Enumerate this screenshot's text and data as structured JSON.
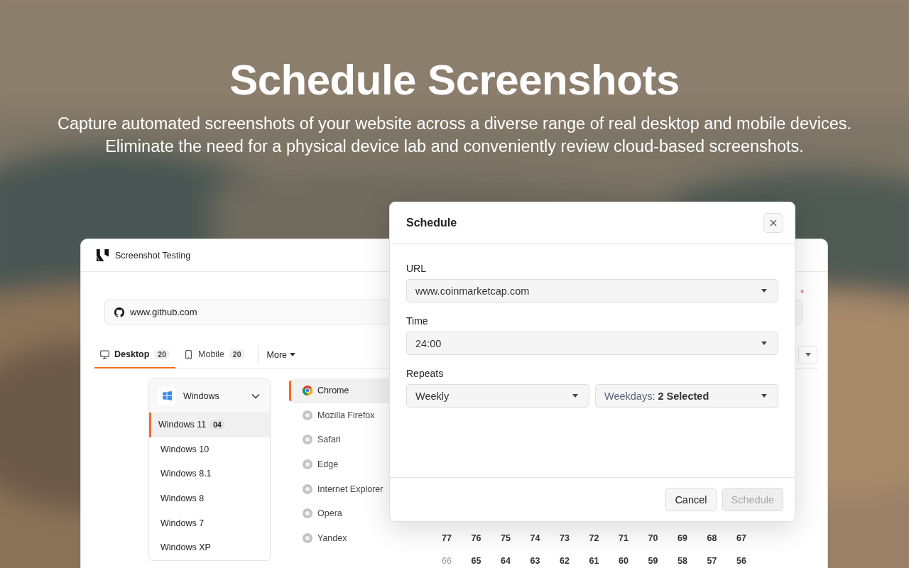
{
  "hero": {
    "title": "Schedule Screenshots",
    "subtitle_lines": [
      "Capture automated screenshots of your website across a diverse range of real desktop and mobile devices.",
      "Eliminate the need for a physical device lab and conveniently review cloud-based screenshots."
    ]
  },
  "app": {
    "title": "Screenshot Testing",
    "url": "www.github.com",
    "required_mark": "*",
    "tabs": [
      {
        "label": "Desktop",
        "count": "20",
        "selected": true,
        "kind": "desktop"
      },
      {
        "label": "Mobile",
        "count": "20",
        "selected": false,
        "kind": "mobile"
      }
    ],
    "more": "More",
    "os_group": {
      "label": "Windows",
      "expanded": true
    },
    "os_versions": [
      {
        "label": "Windows 11",
        "badge": "04",
        "selected": true
      },
      {
        "label": "Windows 10",
        "selected": false
      },
      {
        "label": "Windows 8.1",
        "selected": false
      },
      {
        "label": "Windows 8",
        "selected": false
      },
      {
        "label": "Windows 7",
        "selected": false
      },
      {
        "label": "Windows XP",
        "selected": false
      }
    ],
    "browsers": [
      {
        "label": "Chrome",
        "selected": true
      },
      {
        "label": "Mozilla Firefox",
        "selected": false
      },
      {
        "label": "Safari",
        "selected": false
      },
      {
        "label": "Edge",
        "selected": false
      },
      {
        "label": "Internet Explorer",
        "selected": false
      },
      {
        "label": "Opera",
        "selected": false
      },
      {
        "label": "Yandex",
        "selected": false
      }
    ],
    "grid_rows": [
      [
        {
          "value": "77",
          "disabled": false
        },
        {
          "value": "76",
          "disabled": false
        },
        {
          "value": "75",
          "disabled": false
        },
        {
          "value": "74",
          "disabled": false
        },
        {
          "value": "73",
          "disabled": false
        },
        {
          "value": "72",
          "disabled": false
        },
        {
          "value": "71",
          "disabled": false
        },
        {
          "value": "70",
          "disabled": false
        },
        {
          "value": "69",
          "disabled": false
        },
        {
          "value": "68",
          "disabled": false
        },
        {
          "value": "67",
          "disabled": false
        }
      ],
      [
        {
          "value": "66",
          "disabled": true
        },
        {
          "value": "65",
          "disabled": false
        },
        {
          "value": "64",
          "disabled": false
        },
        {
          "value": "63",
          "disabled": false
        },
        {
          "value": "62",
          "disabled": false
        },
        {
          "value": "61",
          "disabled": false
        },
        {
          "value": "60",
          "disabled": false
        },
        {
          "value": "59",
          "disabled": false
        },
        {
          "value": "58",
          "disabled": false
        },
        {
          "value": "57",
          "disabled": false
        },
        {
          "value": "56",
          "disabled": false
        }
      ]
    ]
  },
  "modal": {
    "title": "Schedule",
    "fields": [
      {
        "label": "URL",
        "selects": [
          {
            "value": "www.coinmarketcap.com"
          }
        ]
      },
      {
        "label": "Time",
        "selects": [
          {
            "value": "24:00"
          }
        ]
      },
      {
        "label": "Repeats",
        "selects": [
          {
            "value": "Weekly"
          },
          {
            "prefix": "Weekdays:",
            "value": "2 Selected"
          }
        ]
      }
    ],
    "buttons": [
      {
        "label": "Cancel",
        "disabled": false
      },
      {
        "label": "Schedule",
        "disabled": true
      }
    ]
  }
}
